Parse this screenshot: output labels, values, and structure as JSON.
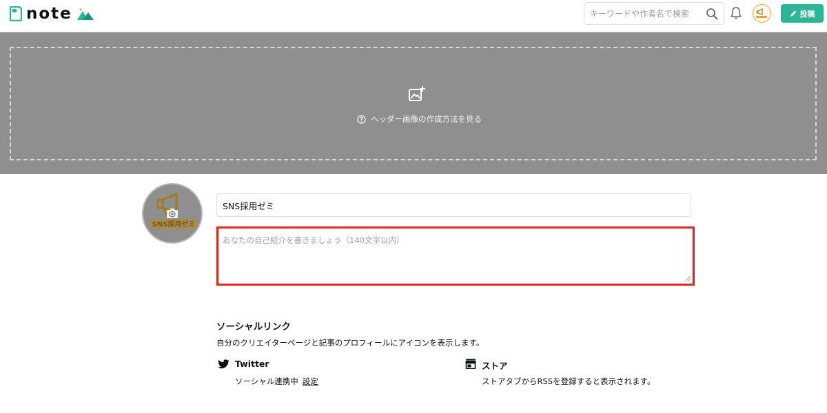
{
  "topbar": {
    "logo_text": "note",
    "search_placeholder": "キーワードや作者名で検索",
    "post_button_label": "投稿",
    "accent_color": "#2cb696"
  },
  "header_image": {
    "help_text": "ヘッダー画像の作成方法を見る"
  },
  "profile": {
    "avatar_text": "SNS採用ゼミ",
    "name_value": "SNS採用ゼミ",
    "bio_placeholder": "あなたの自己紹介を書きましょう（140文字以内）",
    "highlight_color": "#e8241a"
  },
  "social_links": {
    "title": "ソーシャルリンク",
    "description": "自分のクリエイターページと記事のプロフィールにアイコンを表示します。",
    "twitter": {
      "label": "Twitter",
      "status": "ソーシャル連携中",
      "settings_link": "設定"
    },
    "store": {
      "label": "ストア",
      "description": "ストアタブからRSSを登録すると表示されます。"
    }
  }
}
